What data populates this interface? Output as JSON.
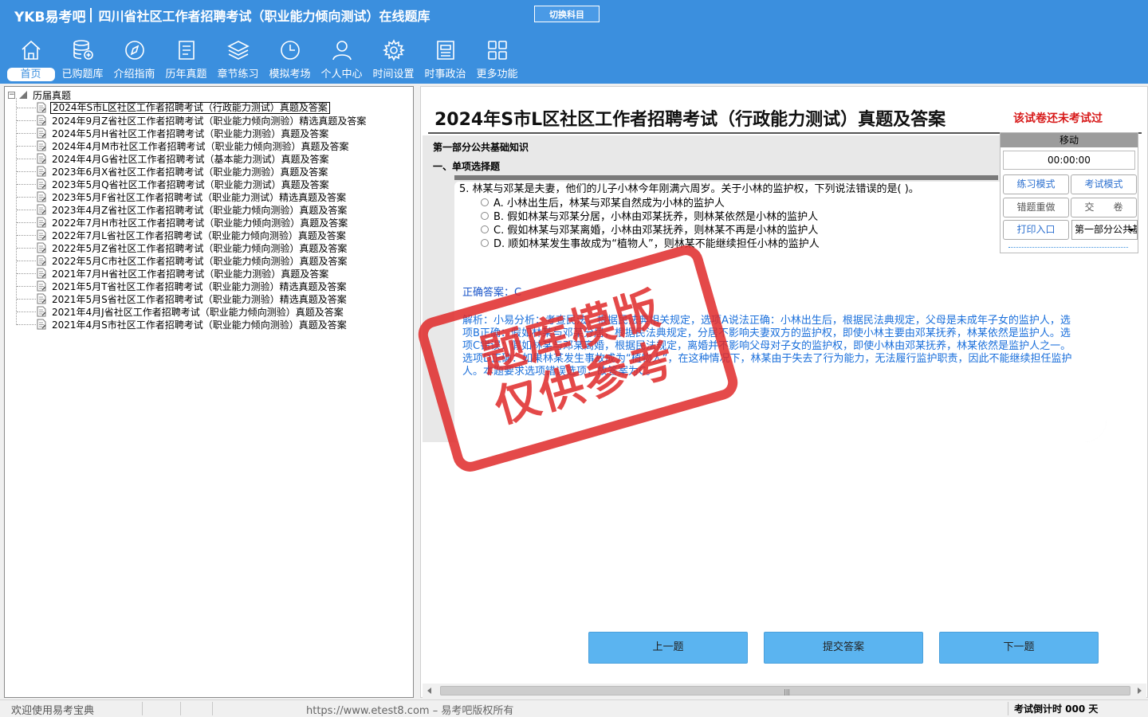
{
  "header": {
    "logo": "YKB易考吧",
    "title": "四川省社区工作者招聘考试（职业能力倾向测试）在线题库",
    "switch_label": "切换科目"
  },
  "toolbar": [
    {
      "label": "首页",
      "icon": "home-icon"
    },
    {
      "label": "已购题库",
      "icon": "database-icon"
    },
    {
      "label": "介绍指南",
      "icon": "compass-icon"
    },
    {
      "label": "历年真题",
      "icon": "document-list-icon"
    },
    {
      "label": "章节练习",
      "icon": "layers-icon"
    },
    {
      "label": "模拟考场",
      "icon": "clock-icon"
    },
    {
      "label": "个人中心",
      "icon": "user-icon"
    },
    {
      "label": "时间设置",
      "icon": "gear-icon"
    },
    {
      "label": "时事政治",
      "icon": "newspaper-icon"
    },
    {
      "label": "更多功能",
      "icon": "grid-icon"
    }
  ],
  "tree": {
    "root_label": "历届真题",
    "items": [
      "2024年S市L区社区工作者招聘考试（行政能力测试）真题及答案",
      "2024年9月Z省社区工作者招聘考试（职业能力倾向测验）精选真题及答案",
      "2024年5月H省社区工作者招聘考试（职业能力测验）真题及答案",
      "2024年4月M市社区工作者招聘考试（职业能力倾向测验）真题及答案",
      "2024年4月G省社区工作者招聘考试（基本能力测试）真题及答案",
      "2023年6月X省社区工作者招聘考试（职业能力测验）真题及答案",
      "2023年5月Q省社区工作者招聘考试（职业能力测试）真题及答案",
      "2023年5月F省社区工作者招聘考试（职业能力测试）精选真题及答案",
      "2023年4月Z省社区工作者招聘考试（职业能力倾向测验）真题及答案",
      "2022年7月H市社区工作者招聘考试（职业能力倾向测验）真题及答案",
      "2022年7月L省社区工作者招聘考试（职业能力倾向测验）真题及答案",
      "2022年5月Z省社区工作者招聘考试（职业能力倾向测验）真题及答案",
      "2022年5月C市社区工作者招聘考试（职业能力倾向测验）真题及答案",
      "2021年7月H省社区工作者招聘考试（职业能力测验）真题及答案",
      "2021年5月T省社区工作者招聘考试（职业能力测验）精选真题及答案",
      "2021年5月S省社区工作者招聘考试（职业能力测验）精选真题及答案",
      "2021年4月J省社区工作者招聘考试（职业能力倾向测验）真题及答案",
      "2021年4月S市社区工作者招聘考试（职业能力倾向测验）真题及答案"
    ]
  },
  "paper": {
    "title": "2024年S市L区社区工作者招聘考试（行政能力测试）真题及答案",
    "status": "该试卷还未考试过",
    "section": "第一部分公共基础知识",
    "subsection": "一、单项选择题"
  },
  "question": {
    "text": "5. 林某与邓某是夫妻，他们的儿子小林今年刚满六周岁。关于小林的监护权，下列说法错误的是( )。",
    "options": [
      "A. 小林出生后，林某与邓某自然成为小林的监护人",
      "B. 假如林某与邓某分居，小林由邓某抚养，则林某依然是小林的监护人",
      "C. 假如林某与邓某离婚，小林由邓某抚养，则林某不再是小林的监护人",
      "D. 顺如林某发生事故成为“植物人”，则林某不能继续担任小林的监护人"
    ],
    "answer": "正确答案：C",
    "analysis": "解析：小易分析：考查民法，根据民法典相关规定，选项A说法正确：小林出生后，根据民法典规定，父母是未成年子女的监护人，选项B正确：假如林某与邓某分居，根据民法典规定，分居不影响夫妻双方的监护权，即使小林主要由邓某抚养，林某依然是监护人。选项C错误：假如林某与邓某离婚，根据民法规定，离婚并不影响父母对子女的监护权，即使小林由邓某抚养，林某依然是监护人之一。选项D正确：如果林某发生事故成为“植物人”，在这种情况下，林某由于失去了行为能力，无法履行监护职责，因此不能继续担任监护人。本题要求选项错误选项，故答案为C。"
  },
  "controls": {
    "move": "移动",
    "timer": "00:00:00",
    "practice_mode": "练习模式",
    "exam_mode": "考试模式",
    "redo_wrong": "错题重做",
    "submit_paper": "交　　卷",
    "print_entry": "打印入口",
    "section_select": "第一部分公共基础知识"
  },
  "watermark": {
    "line1": "题库模版",
    "line2": "仅供参考"
  },
  "nav": {
    "prev": "上一题",
    "submit": "提交答案",
    "next": "下一题"
  },
  "statusbar": {
    "welcome": "欢迎使用易考宝典",
    "copyright": "https://www.etest8.com – 易考吧版权所有",
    "countdown": "考试倒计时 000 天"
  },
  "colors": {
    "header_bg": "#3b8fde",
    "nav_button": "#5bb4f0",
    "status_red": "#d71919",
    "answer_blue": "#1a55c9",
    "stamp_red": "#e02a2a"
  }
}
